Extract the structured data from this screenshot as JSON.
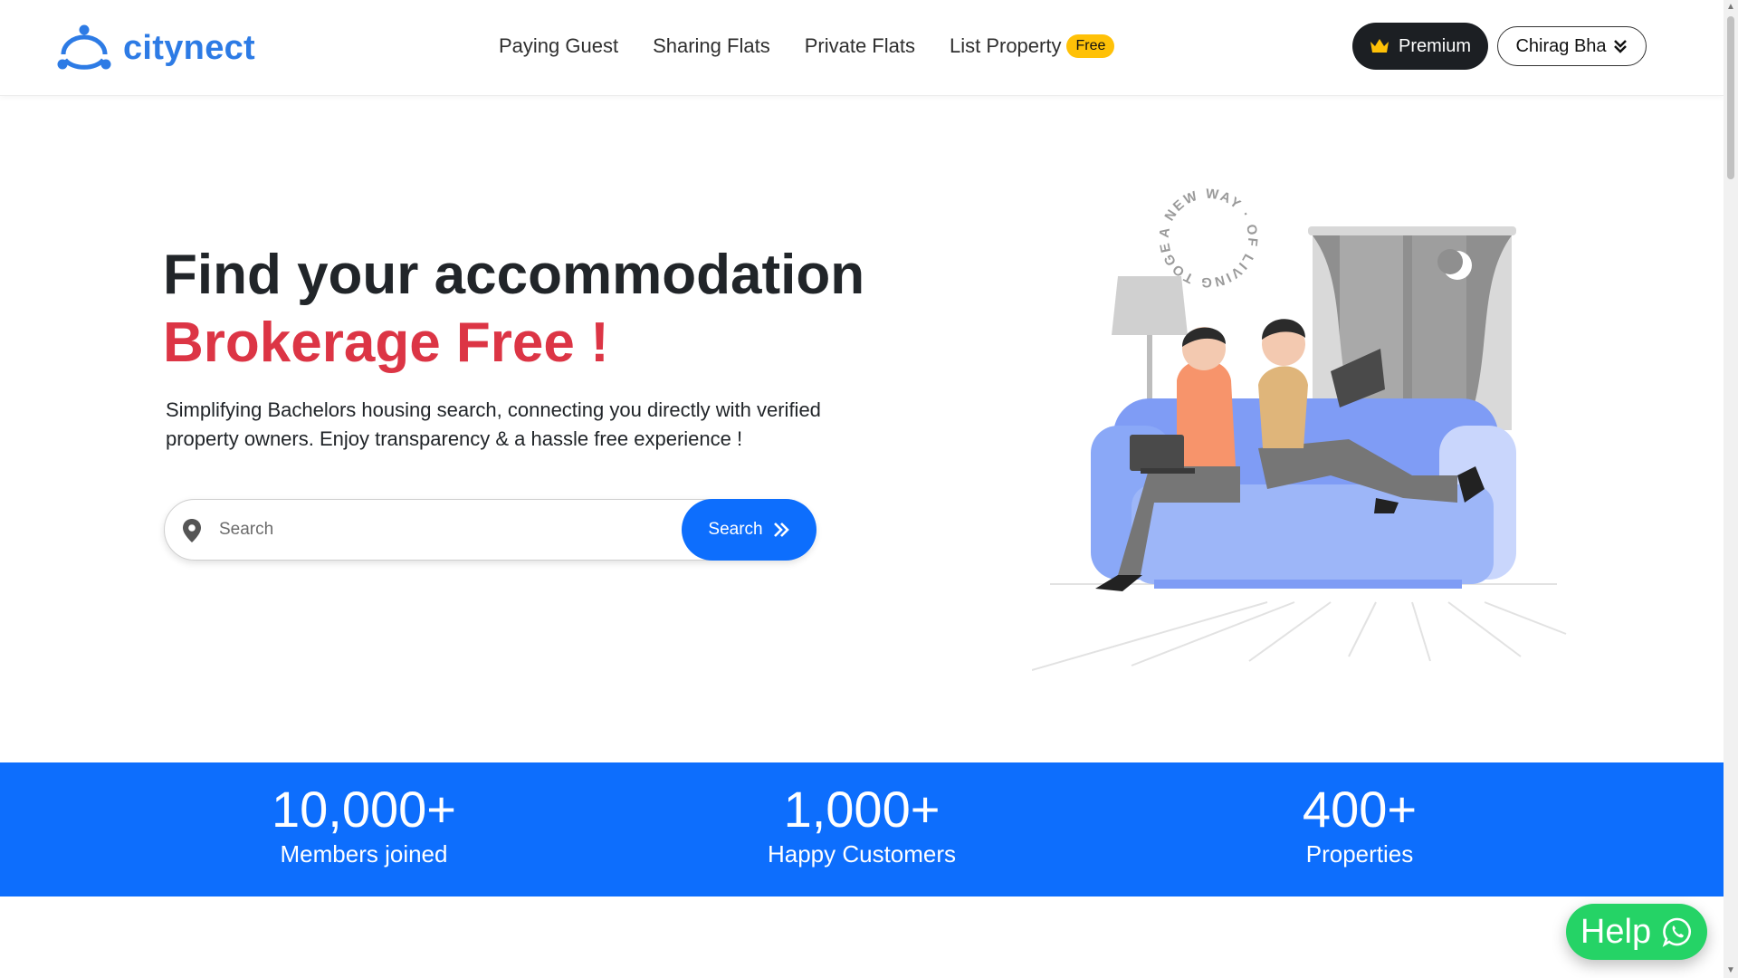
{
  "brand": {
    "name": "citynect",
    "color": "#2d7be5"
  },
  "nav": {
    "links": [
      {
        "label": "Paying Guest"
      },
      {
        "label": "Sharing Flats"
      },
      {
        "label": "Private Flats"
      },
      {
        "label": "List Property",
        "badge": "Free"
      }
    ]
  },
  "header": {
    "premium_label": "Premium",
    "user_label": "Chirag Bha"
  },
  "hero": {
    "title": "Find your accommodation",
    "subtitle": "Brokerage Free !",
    "description": "Simplifying Bachelors housing search, connecting you directly with verified property owners. Enjoy transparency & a hassle free experience !",
    "search_placeholder": "Search",
    "search_button": "Search",
    "illustration_text": "A NEW WAY · OF LIVING TOGETHER ·"
  },
  "stats": [
    {
      "value": "10,000+",
      "label": "Members joined"
    },
    {
      "value": "1,000+",
      "label": "Happy Customers"
    },
    {
      "value": "400+",
      "label": "Properties"
    }
  ],
  "help": {
    "label": "Help"
  },
  "colors": {
    "primary": "#0d6efd",
    "accent_red": "#dc3545",
    "badge_yellow": "#ffc107",
    "whatsapp_green": "#25d366",
    "dark": "#1c1f23"
  },
  "icons": [
    "citynect-logo-icon",
    "crown-icon",
    "chevron-double-down-icon",
    "location-pin-icon",
    "chevron-double-right-icon",
    "whatsapp-icon"
  ]
}
